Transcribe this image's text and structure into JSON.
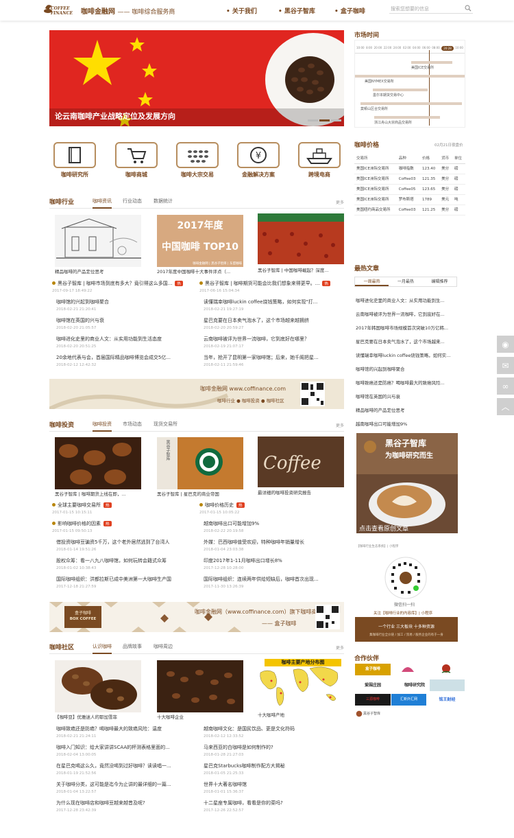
{
  "header": {
    "site_name": "咖啡金融网",
    "tagline": "—— 咖啡综合服务商",
    "logo_text": "COFFEE FINANCE",
    "nav": [
      "关于我们",
      "黑谷子智库",
      "盒子咖啡"
    ],
    "search_placeholder": "搜索您想要的信息"
  },
  "banner": {
    "title": "论云南咖啡产业战略定位及发展方向"
  },
  "categories": [
    "咖啡研究所",
    "咖啡商城",
    "咖啡大宗交易",
    "金融解决方案",
    "跨境电商"
  ],
  "sec1": {
    "title": "咖啡行业",
    "tabs": [
      "咖啡资讯",
      "行业动态",
      "数据统计"
    ],
    "more": "更多",
    "pics": [
      {
        "cap": "精品咖啡的产品定位思考"
      },
      {
        "cap": "2017年度中国咖啡十大事件评点（...",
        "img_title": "2017年度",
        "img_sub": "中国咖啡  TOP10",
        "img_note": "咖啡金融网 | 黑谷子智库 | 东盟咖啡"
      },
      {
        "cap": "黑谷子智库 | 中国咖啡崛起？深度..."
      }
    ],
    "left": [
      {
        "t": "黑谷子智库 | 咖啡市场到底有多大？竟引得这么多国...",
        "d": "2017-09-17 18:49:22",
        "hot": true
      },
      {
        "t": "咖啡馆的兴起到咖啡聚合",
        "d": "2018-02-21 21:20:41"
      },
      {
        "t": "咖啡馆在英国的兴与衰",
        "d": "2018-02-20 21:05:57"
      },
      {
        "t": "咖啡进化史里的商业人文：从实用功能到生活态度",
        "d": "2018-02-20 20:51:25"
      },
      {
        "t": "20余地代表与会，首届国际精品咖啡博览会成交5亿...",
        "d": "2018-02-12 12:42:32"
      }
    ],
    "right": [
      {
        "t": "黑谷子智库 | 咖啡期货可能会比我们想象来得更早。...",
        "d": "2017-06-16 15:04:34",
        "hot": true
      },
      {
        "t": "读懂瑞幸咖啡luckin coffee烧钱策略，如何实现\"打...",
        "d": "2018-02-21 19:27:19"
      },
      {
        "t": "星巴克要在日本卖气泡水了，这个市场越来越拥挤",
        "d": "2018-02-20 20:59:27"
      },
      {
        "t": "云南咖啡被评为世界一流咖啡，它到底好在哪里？",
        "d": "2018-02-19 21:07:17"
      },
      {
        "t": "当年，抢开了昆明第一家咖啡馆；后来，她千阁把星...",
        "d": "2018-02-11 21:59:46"
      }
    ]
  },
  "ad1": {
    "site": "咖啡金融网 www.coffinance.com",
    "tags": "咖啡行业 ● 咖啡投资 ● 咖啡社区"
  },
  "sec2": {
    "title": "咖啡投资",
    "tabs": [
      "咖啡投资",
      "市场动态",
      "现货交易所"
    ],
    "more": "更多",
    "pics": [
      {
        "cap": "黑谷子智库 | 咖啡期货上线在即，..."
      },
      {
        "cap": "黑谷子智库 | 星巴克的商业帝国",
        "img_label": "黑谷子智库"
      },
      {
        "cap": "最详细的咖啡投资研究报告",
        "img_title": "Coffee"
      }
    ],
    "left": [
      {
        "t": "全球主要咖啡交易所",
        "d": "2017-01-15 10:15:11",
        "hot": true
      },
      {
        "t": "影响咖啡价格的因素",
        "d": "2017-01-15 09:50:13",
        "hot": true
      },
      {
        "t": "借投资咖啡豆骗资5千万，这个老外居然逃到了台湾人",
        "d": "2018-01-14 19:51:26"
      },
      {
        "t": "股权众筹：看一八九八咖啡馆，如何玩转会籍式众筹",
        "d": "2018-01-02 10:38:43"
      },
      {
        "t": "国际咖啡组织：洪都拉斯已成中美洲第一大咖啡生产国",
        "d": "2017-12-18 21:27:59"
      }
    ],
    "right": [
      {
        "t": "咖啡价格历史",
        "d": "2017-01-15 10:05:22",
        "hot": true
      },
      {
        "t": "越南咖啡出口可能增加9%",
        "d": "2018-02-22 20:19:58"
      },
      {
        "t": "外媒：巴西咖啡值受欢迎，特种咖啡年销量增长",
        "d": "2018-01-04 23:03:38"
      },
      {
        "t": "印度2017年1-11月咖啡出口增长8%",
        "d": "2017-12-28 10:28:00"
      },
      {
        "t": "国际咖啡组织：连续两年供给短缺后，咖啡首次出现...",
        "d": "2017-11-30 13:26:39"
      }
    ]
  },
  "ad2": {
    "brand": "盒子咖啡",
    "brand_en": "BOX COFFEE",
    "text": "咖啡金融网（www.coffinance.com）旗下咖啡商城",
    "sub": "—— 盒子咖啡"
  },
  "sec3": {
    "title": "咖啡社区",
    "tabs": [
      "认识咖啡",
      "品牌故事",
      "咖啡周边"
    ],
    "more": "更多",
    "pics": [
      {
        "cap": "【咖啡豆】优雅迷人的耶加雪菲"
      },
      {
        "cap": "十大咖啡企业"
      },
      {
        "cap": "十大咖啡产地",
        "img_title": "咖啡主要产地分布图"
      }
    ],
    "left": [
      {
        "t": "咖啡致癌还是防癌？喝咖啡最大的致癌风险：温度",
        "d": "2018-02-21 21:24:11"
      },
      {
        "t": "咖啡入门知识：给大家讲讲SCAA的杯测表格里面的...",
        "d": "2018-02-04 13:00:05"
      },
      {
        "t": "在星巴克喝这么久，竟然没喝到过好咖啡？读读唱一...",
        "d": "2018-01-19 21:52:56"
      },
      {
        "t": "关于咖啡分类，这可能是迄今为止讲的最详细的一篇...",
        "d": "2018-01-04 13:22:57"
      },
      {
        "t": "为什么现在咖啡店和咖啡豆越来越昔及呢?",
        "d": "2017-12-28 23:42:39"
      }
    ],
    "right": [
      {
        "t": "越南咖啡文化：是国民饮品、更是文化符码",
        "d": "2018-02-12 12:33:52"
      },
      {
        "t": "马来西亚的白咖啡是如何制作的?",
        "d": "2018-01-28 21:27:03"
      },
      {
        "t": "星巴克Starbucks咖啡制作配方大揭秘",
        "d": "2018-01-05 21:25:33"
      },
      {
        "t": "世界十大著名咖啡馆",
        "d": "2018-01-01 15:36:37"
      },
      {
        "t": "十二星座专属咖啡，看看是你的菜吗?",
        "d": "2017-12-26 22:52:57"
      }
    ]
  },
  "market": {
    "title": "市场时间",
    "times": [
      "10:00",
      "8:00",
      "20:00",
      "22:00",
      "24:00",
      "02:00",
      "04:00",
      "06:00",
      "08:00",
      "20:28",
      "10:00"
    ],
    "current": "20:28",
    "exchanges": [
      "美国ICE交易所",
      "美国NYMEX交易所",
      "墨尔本期货交易中心",
      "莫顿山区合交易所",
      "浙江舟山大宗商品交易所"
    ]
  },
  "prices": {
    "title": "咖啡价格",
    "date": "02月21日夜盘价",
    "headers": [
      "交易所",
      "品种",
      "价格",
      "货币",
      "单位"
    ],
    "rows": [
      [
        "美国ICE洲际交易所",
        "咖啡指数",
        "123.40",
        "美分",
        "磅"
      ],
      [
        "美国ICE洲际交易所",
        "Coffee03",
        "121.35",
        "美分",
        "磅"
      ],
      [
        "美国ICE洲际交易所",
        "Coffee05",
        "123.65",
        "美分",
        "磅"
      ],
      [
        "美国ICE洲际交易所",
        "罗布斯塔",
        "1789",
        "美元",
        "吨"
      ],
      [
        "美国纽约商品交易所",
        "Coffee03",
        "121.25",
        "美分",
        "磅"
      ]
    ]
  },
  "hot": {
    "title": "最热文章",
    "tabs": [
      "一周最热",
      "一月最热",
      "编辑推荐"
    ],
    "items": [
      "咖啡进化史里的商业人文：从实用功能到生...",
      "云南咖啡被评为世界一流咖啡，它到底好在...",
      "2017年韩国咖啡市场规模首次突破10万亿韩...",
      "星巴克要在日本卖气泡水了，这个市场越来...",
      "读懂瑞幸咖啡luckin coffee烧钱策略，如何实...",
      "咖啡馆的兴起到咖啡聚合",
      "咖啡致癌还是防癌？喝咖啡最大的致癌风险...",
      "咖啡馆在英国的兴与衰",
      "精品咖啡的产品定位思考",
      "越南咖啡出口可能增加9%"
    ]
  },
  "promo": {
    "title": "黑谷子智库",
    "sub": "为咖啡研究而生",
    "cta": "点击查看原创文章"
  },
  "qr": {
    "label": "【咖啡行业生态系统】| 小程序",
    "scan": "微信扫一扫",
    "follow": "关注【咖啡行业的内容库】| 小程序",
    "slogan": "一个行业  三大板块  十多种资源",
    "desc": "集咖啡行业全价链 / 加工 / 贸易 / 服务企业的有于一身"
  },
  "partners": {
    "title": "合作伙伴",
    "logos": [
      "盒子咖啡",
      "",
      "",
      "爱围庄园",
      "咖啡研究院",
      "",
      "三源咖啡",
      "汇新外汇网",
      "铭王财经",
      "黑谷子智库"
    ]
  },
  "colors": {
    "brand": "#7a4a22",
    "accent": "#b68d5e",
    "hot": "#e04020"
  }
}
